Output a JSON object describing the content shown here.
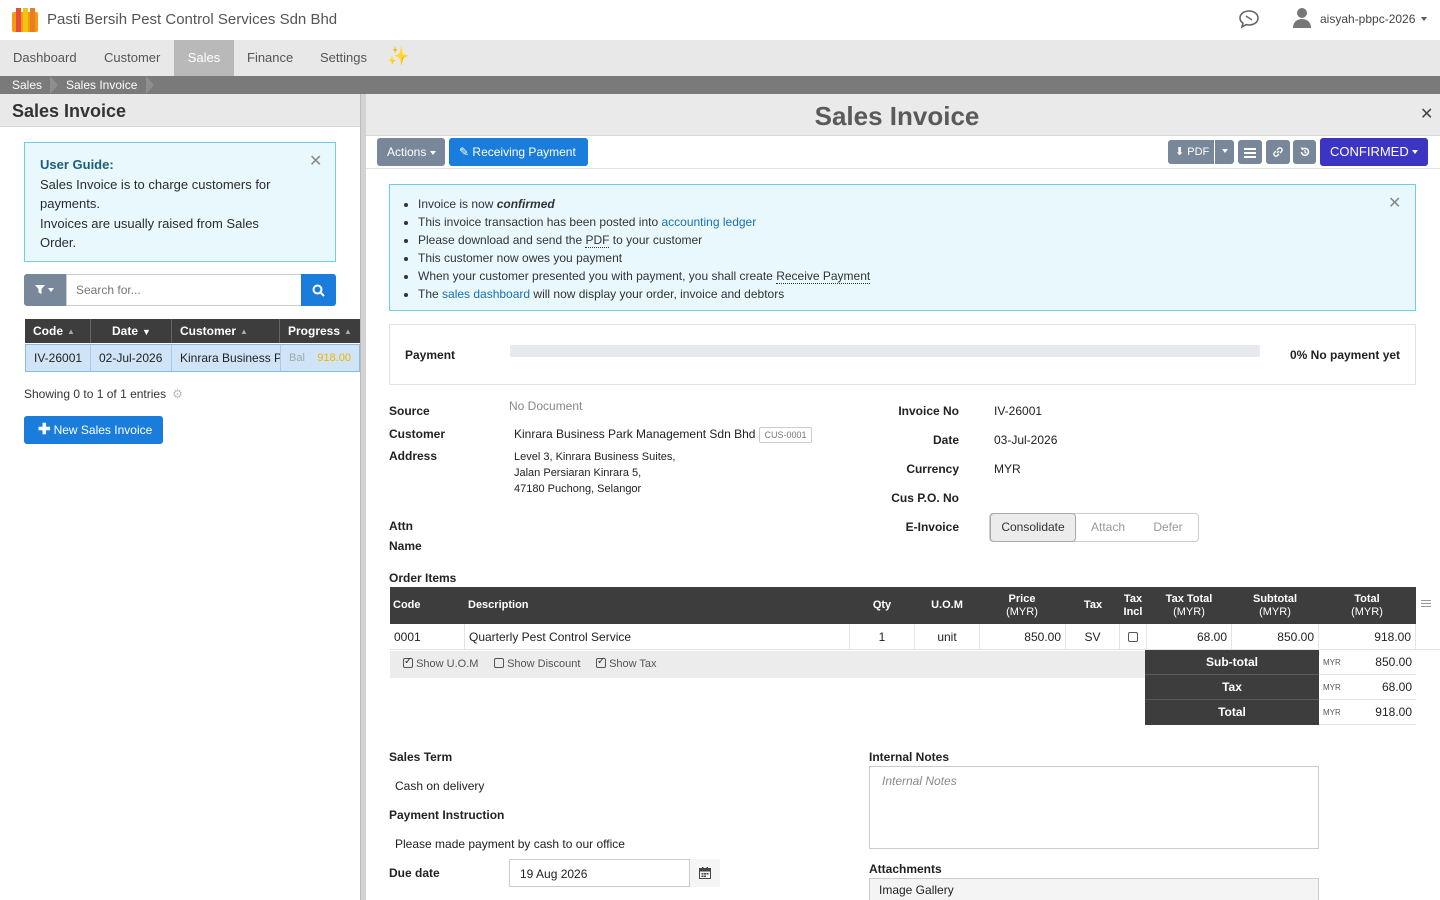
{
  "app": {
    "company_name": "Pasti Bersih Pest Control Services Sdn Bhd",
    "username": "aisyah-pbpc-2026",
    "icons": [
      "logo-icon",
      "chat-icon",
      "user-icon"
    ]
  },
  "nav": {
    "items": [
      "Dashboard",
      "Customer",
      "Sales",
      "Finance",
      "Settings"
    ],
    "active": "Sales",
    "sparkle": "✨"
  },
  "breadcrumb": [
    "Sales",
    "Sales Invoice"
  ],
  "left": {
    "title": "Sales Invoice",
    "guide": {
      "title": "User Guide:",
      "line1": "Sales Invoice is to charge customers for payments.",
      "line2": "Invoices are usually raised from Sales Order."
    },
    "search_placeholder": "Search for...",
    "table": {
      "headers": [
        "Code",
        "Date",
        "Customer",
        "Progress"
      ],
      "rows": [
        {
          "code": "IV-26001",
          "date": "02-Jul-2026",
          "customer": "Kinrara Business Park Management Sdn Bhd",
          "bal_label": "Bal",
          "bal": "918.00"
        }
      ]
    },
    "showing": "Showing 0 to 1 of 1 entries",
    "new_button": "New Sales Invoice"
  },
  "doc": {
    "title": "Sales Invoice",
    "toolbar": {
      "actions": "Actions",
      "receiving": "Receiving Payment",
      "pdf": "PDF",
      "status": "CONFIRMED"
    },
    "info": {
      "l1_pre": "Invoice is now ",
      "l1_em": "confirmed",
      "l2_pre": "This invoice transaction has been posted into ",
      "l2_link": "accounting ledger",
      "l3_pre": "Please download and send the ",
      "l3_link": "PDF",
      "l3_post": " to your customer",
      "l4": "This customer now owes you payment",
      "l5_pre": "When your customer presented you with payment, you shall create ",
      "l5_link": "Receive Payment",
      "l6_pre": "The ",
      "l6_link": "sales dashboard",
      "l6_post": " will now display your order, invoice and debtors"
    },
    "payment": {
      "label": "Payment",
      "progress": 0,
      "status": "0% No payment yet"
    },
    "fields": {
      "source_label": "Source",
      "source": "No Document",
      "customer_label": "Customer",
      "customer": "Kinrara Business Park Management Sdn Bhd",
      "customer_code": "CUS-0001",
      "address_label": "Address",
      "address1": "Level 3, Kinrara Business Suites,",
      "address2": "Jalan Persiaran Kinrara 5,",
      "address3": "47180 Puchong, Selangor",
      "attn_label1": "Attn",
      "attn_label2": "Name",
      "invoice_no_label": "Invoice No",
      "invoice_no": "IV-26001",
      "date_label": "Date",
      "date": "03-Jul-2026",
      "currency_label": "Currency",
      "currency": "MYR",
      "po_label": "Cus P.O. No",
      "einvoice_label": "E-Invoice",
      "einvoice_options": [
        "Consolidate",
        "Attach",
        "Defer"
      ],
      "einvoice_selected": "Consolidate"
    },
    "order": {
      "label": "Order Items",
      "headers": {
        "code": "Code",
        "description": "Description",
        "qty": "Qty",
        "uom": "U.O.M",
        "price": "Price",
        "price_cur": "(MYR)",
        "tax": "Tax",
        "tax_incl1": "Tax",
        "tax_incl2": "Incl",
        "tax_total": "Tax Total",
        "tax_total_cur": "(MYR)",
        "subtotal": "Subtotal",
        "subtotal_cur": "(MYR)",
        "total": "Total",
        "total_cur": "(MYR)"
      },
      "items": [
        {
          "code": "0001",
          "description": "Quarterly Pest Control Service",
          "qty": "1",
          "uom": "unit",
          "price": "850.00",
          "tax": "SV",
          "tax_incl": false,
          "tax_total": "68.00",
          "subtotal": "850.00",
          "total": "918.00"
        }
      ],
      "options": {
        "show_uom": "Show U.O.M",
        "show_uom_checked": true,
        "show_discount": "Show Discount",
        "show_discount_checked": false,
        "show_tax": "Show Tax",
        "show_tax_checked": true
      },
      "totals": {
        "subtotal_label": "Sub-total",
        "subtotal": "850.00",
        "tax_label": "Tax",
        "tax": "68.00",
        "total_label": "Total",
        "total": "918.00",
        "currency": "MYR"
      }
    },
    "terms": {
      "sales_term_label": "Sales Term",
      "sales_term": "Cash on delivery",
      "payment_instruction_label": "Payment Instruction",
      "payment_instruction": "Please made payment by cash to our office",
      "due_date_label": "Due date",
      "due_date": "19 Aug 2026",
      "internal_notes_label": "Internal Notes",
      "internal_notes_placeholder": "Internal Notes",
      "attachments_label": "Attachments",
      "image_gallery": "Image Gallery"
    }
  }
}
